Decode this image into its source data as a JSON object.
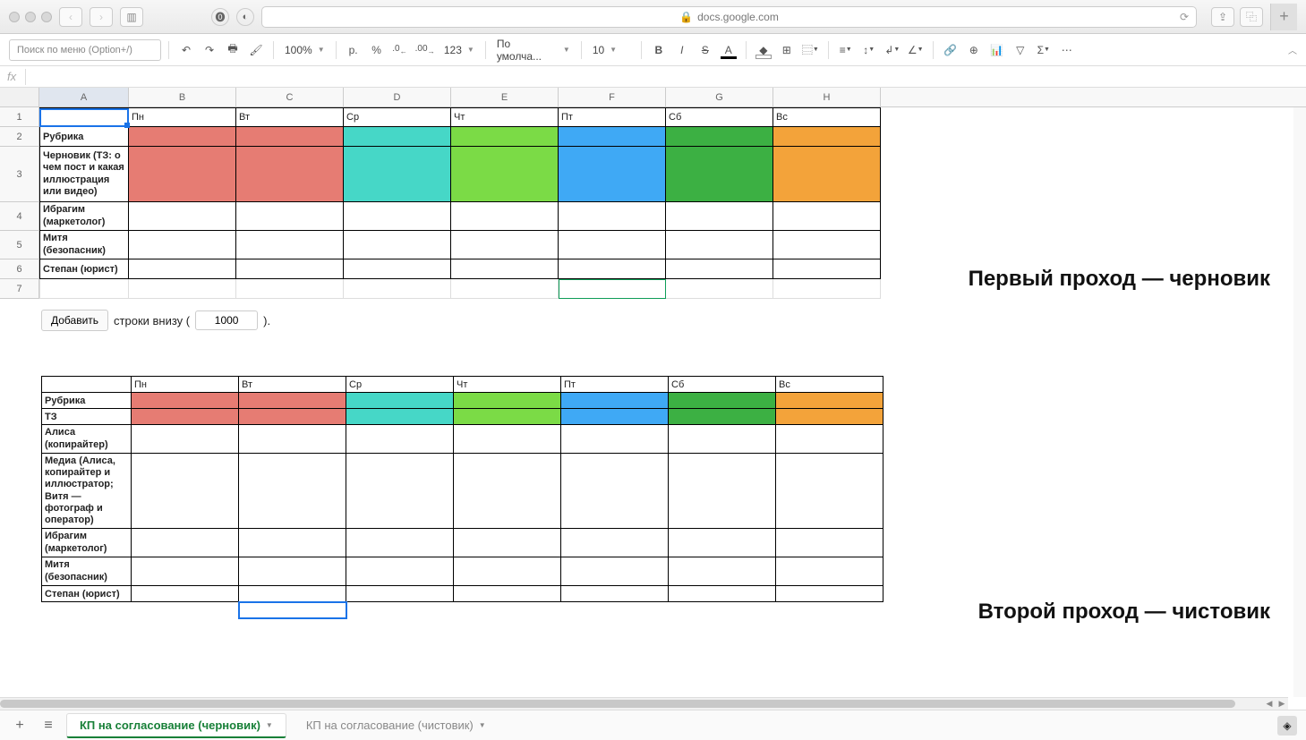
{
  "browser": {
    "url": "docs.google.com"
  },
  "toolbar": {
    "menu_search_placeholder": "Поиск по меню (Option+/)",
    "zoom": "100%",
    "currency": "p.",
    "percent": "%",
    "dec_dec": ".0",
    "dec_inc": ".00",
    "num_format": "123",
    "font": "По умолча...",
    "font_size": "10",
    "text_A": "A"
  },
  "formula": {
    "fx": "fx"
  },
  "columns": [
    "A",
    "B",
    "C",
    "D",
    "E",
    "F",
    "G",
    "H"
  ],
  "row_numbers": [
    "1",
    "2",
    "3",
    "4",
    "5",
    "6",
    "7"
  ],
  "table1": {
    "headers": [
      "",
      "Пн",
      "Вт",
      "Ср",
      "Чт",
      "Пт",
      "Сб",
      "Вс"
    ],
    "rows": [
      {
        "label": "Рубрика",
        "colors": [
          "c-red",
          "c-red",
          "c-teal",
          "c-lgreen",
          "c-blue",
          "c-green",
          "c-orange"
        ]
      },
      {
        "label": "Черновик (ТЗ: о чем пост и какая иллюстрация или видео)",
        "colors": [
          "c-red",
          "c-red",
          "c-teal",
          "c-lgreen",
          "c-blue",
          "c-green",
          "c-orange"
        ]
      },
      {
        "label": "Ибрагим (маркетолог)",
        "colors": [
          "",
          "",
          "",
          "",
          "",
          "",
          ""
        ]
      },
      {
        "label": "Митя (безопасник)",
        "colors": [
          "",
          "",
          "",
          "",
          "",
          "",
          ""
        ]
      },
      {
        "label": "Степан (юрист)",
        "colors": [
          "",
          "",
          "",
          "",
          "",
          "",
          ""
        ]
      }
    ]
  },
  "add_rows": {
    "btn": "Добавить",
    "before": "строки внизу (",
    "value": "1000",
    "after": ")."
  },
  "table2": {
    "headers": [
      "",
      "Пн",
      "Вт",
      "Ср",
      "Чт",
      "Пт",
      "Сб",
      "Вс"
    ],
    "rows": [
      {
        "label": "Рубрика",
        "colors": [
          "c-red",
          "c-red",
          "c-teal",
          "c-lgreen",
          "c-blue",
          "c-green",
          "c-orange"
        ]
      },
      {
        "label": "ТЗ",
        "colors": [
          "c-red",
          "c-red",
          "c-teal",
          "c-lgreen",
          "c-blue",
          "c-green",
          "c-orange"
        ]
      },
      {
        "label": "Алиса (копирайтер)",
        "colors": [
          "",
          "",
          "",
          "",
          "",
          "",
          ""
        ]
      },
      {
        "label": "Медиа (Алиса, копирайтер и иллюстратор; Витя — фотограф и оператор)",
        "colors": [
          "",
          "",
          "",
          "",
          "",
          "",
          ""
        ]
      },
      {
        "label": "Ибрагим (маркетолог)",
        "colors": [
          "",
          "",
          "",
          "",
          "",
          "",
          ""
        ]
      },
      {
        "label": "Митя (безопасник)",
        "colors": [
          "",
          "",
          "",
          "",
          "",
          "",
          ""
        ]
      },
      {
        "label": "Степан (юрист)",
        "colors": [
          "",
          "",
          "",
          "",
          "",
          "",
          ""
        ]
      }
    ]
  },
  "captions": {
    "first": "Первый проход — черновик",
    "second": "Второй проход — чистовик"
  },
  "tabs": {
    "active": "КП на согласование (черновик)",
    "inactive": "КП на согласование (чистовик)"
  }
}
